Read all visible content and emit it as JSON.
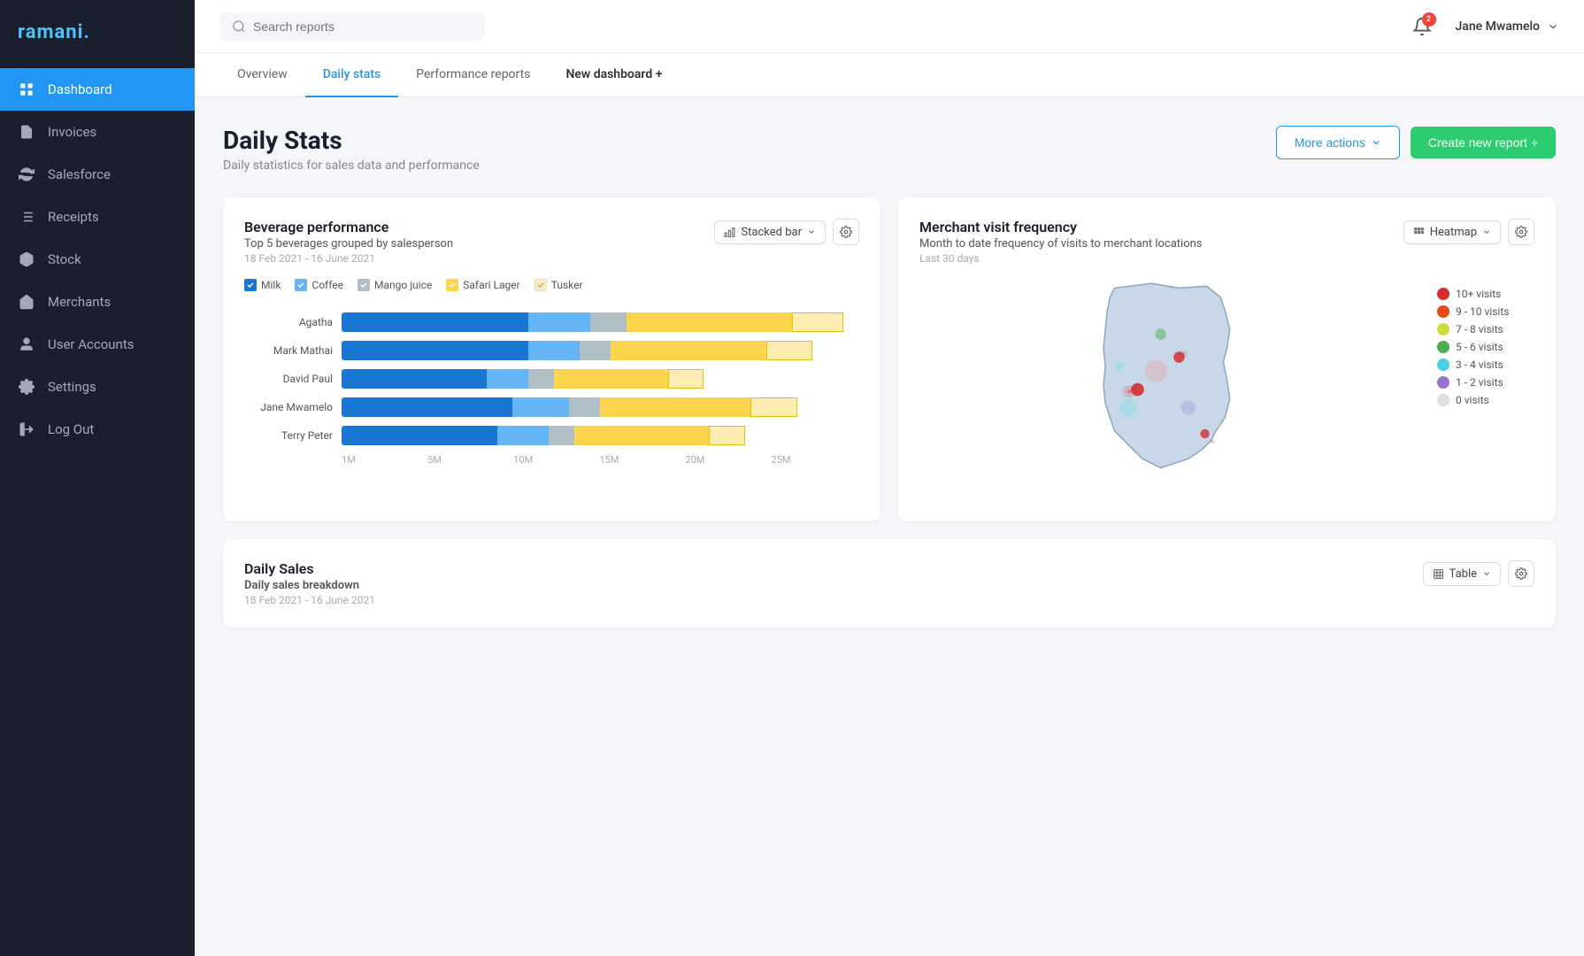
{
  "app": {
    "name": "ramani",
    "logo_accent": "."
  },
  "sidebar": {
    "items": [
      {
        "id": "dashboard",
        "label": "Dashboard",
        "icon": "grid-icon",
        "active": true
      },
      {
        "id": "invoices",
        "label": "Invoices",
        "icon": "file-text-icon",
        "active": false
      },
      {
        "id": "salesforce",
        "label": "Salesforce",
        "icon": "refresh-icon",
        "active": false
      },
      {
        "id": "receipts",
        "label": "Receipts",
        "icon": "list-icon",
        "active": false
      },
      {
        "id": "stock",
        "label": "Stock",
        "icon": "box-icon",
        "active": false
      },
      {
        "id": "merchants",
        "label": "Merchants",
        "icon": "building-icon",
        "active": false
      },
      {
        "id": "user-accounts",
        "label": "User Accounts",
        "icon": "user-icon",
        "active": false
      },
      {
        "id": "settings",
        "label": "Settings",
        "icon": "settings-icon",
        "active": false
      },
      {
        "id": "logout",
        "label": "Log Out",
        "icon": "logout-icon",
        "active": false
      }
    ]
  },
  "topbar": {
    "search_placeholder": "Search reports",
    "notification_count": "2",
    "user_name": "Jane Mwamelo"
  },
  "tabs": [
    {
      "id": "overview",
      "label": "Overview",
      "active": false
    },
    {
      "id": "daily-stats",
      "label": "Daily stats",
      "active": true
    },
    {
      "id": "performance-reports",
      "label": "Performance reports",
      "active": false
    },
    {
      "id": "new-dashboard",
      "label": "New dashboard +",
      "active": false,
      "bold": true
    }
  ],
  "page": {
    "title": "Daily Stats",
    "subtitle": "Daily statistics for sales data and performance",
    "more_actions_label": "More actions",
    "create_report_label": "Create new report +"
  },
  "beverage_chart": {
    "title": "Beverage performance",
    "subtitle": "Top 5 beverages grouped by salesperson",
    "date_range": "18 Feb 2021 - 16 June 2021",
    "chart_type": "Stacked bar",
    "legend": [
      {
        "label": "Milk",
        "color": "#1976D2",
        "checked": true
      },
      {
        "label": "Coffee",
        "color": "#64B5F6",
        "checked": true
      },
      {
        "label": "Mango juice",
        "color": "#B0BEC5",
        "checked": true
      },
      {
        "label": "Safari Lager",
        "color": "#FFD54F",
        "checked": true
      },
      {
        "label": "Tusker",
        "color": "#FFECB3",
        "checked": true
      }
    ],
    "rows": [
      {
        "label": "Agatha",
        "segments": [
          0.28,
          0.1,
          0.06,
          0.26,
          0.08
        ]
      },
      {
        "label": "Mark Mathai",
        "segments": [
          0.28,
          0.08,
          0.05,
          0.25,
          0.07
        ]
      },
      {
        "label": "David Paul",
        "segments": [
          0.22,
          0.06,
          0.04,
          0.18,
          0.06
        ]
      },
      {
        "label": "Jane Mwamelo",
        "segments": [
          0.26,
          0.09,
          0.05,
          0.24,
          0.07
        ]
      },
      {
        "label": "Terry Peter",
        "segments": [
          0.24,
          0.08,
          0.04,
          0.22,
          0.06
        ]
      }
    ],
    "x_axis": [
      "1M",
      "5M",
      "10M",
      "15M",
      "20M",
      "25M"
    ]
  },
  "heatmap_chart": {
    "title": "Merchant visit frequency",
    "subtitle": "Month to date frequency of visits to merchant locations",
    "date_range": "Last 30 days",
    "chart_type": "Heatmap",
    "legend": [
      {
        "label": "10+ visits",
        "color": "#d32f2f"
      },
      {
        "label": "9 - 10 visits",
        "color": "#e64a19"
      },
      {
        "label": "7 - 8 visits",
        "color": "#cddc39"
      },
      {
        "label": "5 - 6 visits",
        "color": "#4caf50"
      },
      {
        "label": "3 - 4 visits",
        "color": "#4dd0e1"
      },
      {
        "label": "1 - 2 visits",
        "color": "#9575cd"
      },
      {
        "label": "0 visits",
        "color": "#e0e0e0"
      }
    ]
  },
  "daily_sales": {
    "title": "Daily Sales",
    "subtitle": "Daily sales breakdown",
    "date_range": "18 Feb 2021 - 16 June 2021",
    "chart_type": "Table"
  }
}
